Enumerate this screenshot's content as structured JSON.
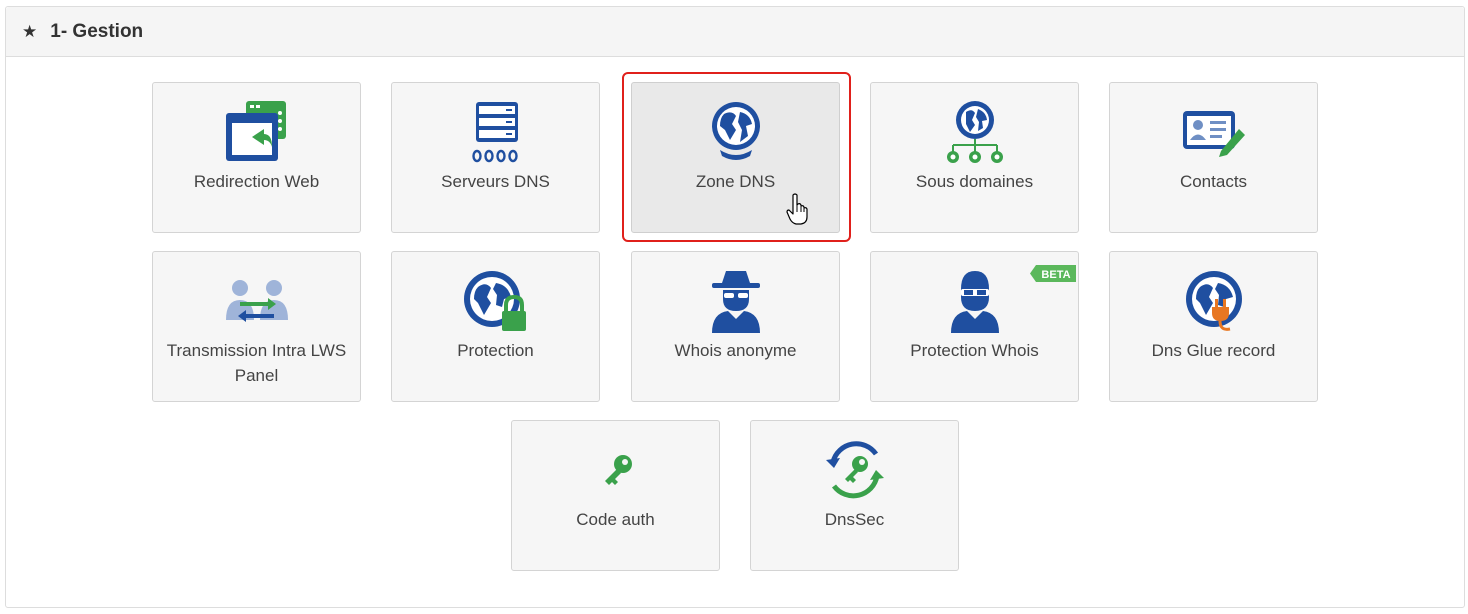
{
  "section": {
    "star_icon": "star-icon",
    "title": "1- Gestion"
  },
  "tiles": [
    {
      "label": "Redirection Web",
      "icon": "redirect-window-icon"
    },
    {
      "label": "Serveurs DNS",
      "icon": "server-rack-icon"
    },
    {
      "label": "Zone DNS",
      "icon": "globe-stand-icon",
      "state": "hovered/selected"
    },
    {
      "label": "Sous domaines",
      "icon": "globe-tree-icon"
    },
    {
      "label": "Contacts",
      "icon": "contact-card-icon"
    },
    {
      "label": "Transmission Intra LWS Panel",
      "icon": "user-transfer-icon"
    },
    {
      "label": "Protection",
      "icon": "globe-lock-icon"
    },
    {
      "label": "Whois anonyme",
      "icon": "spy-icon"
    },
    {
      "label": "Protection Whois",
      "icon": "masked-user-icon",
      "badge": "BETA"
    },
    {
      "label": "Dns Glue record",
      "icon": "globe-plug-icon"
    },
    {
      "label": "Code auth",
      "icon": "key-icon"
    },
    {
      "label": "DnsSec",
      "icon": "key-refresh-icon"
    }
  ],
  "colors": {
    "brand_blue": "#1f4fa0",
    "brand_green": "#3aa14b",
    "highlight_red": "#e0201b"
  }
}
